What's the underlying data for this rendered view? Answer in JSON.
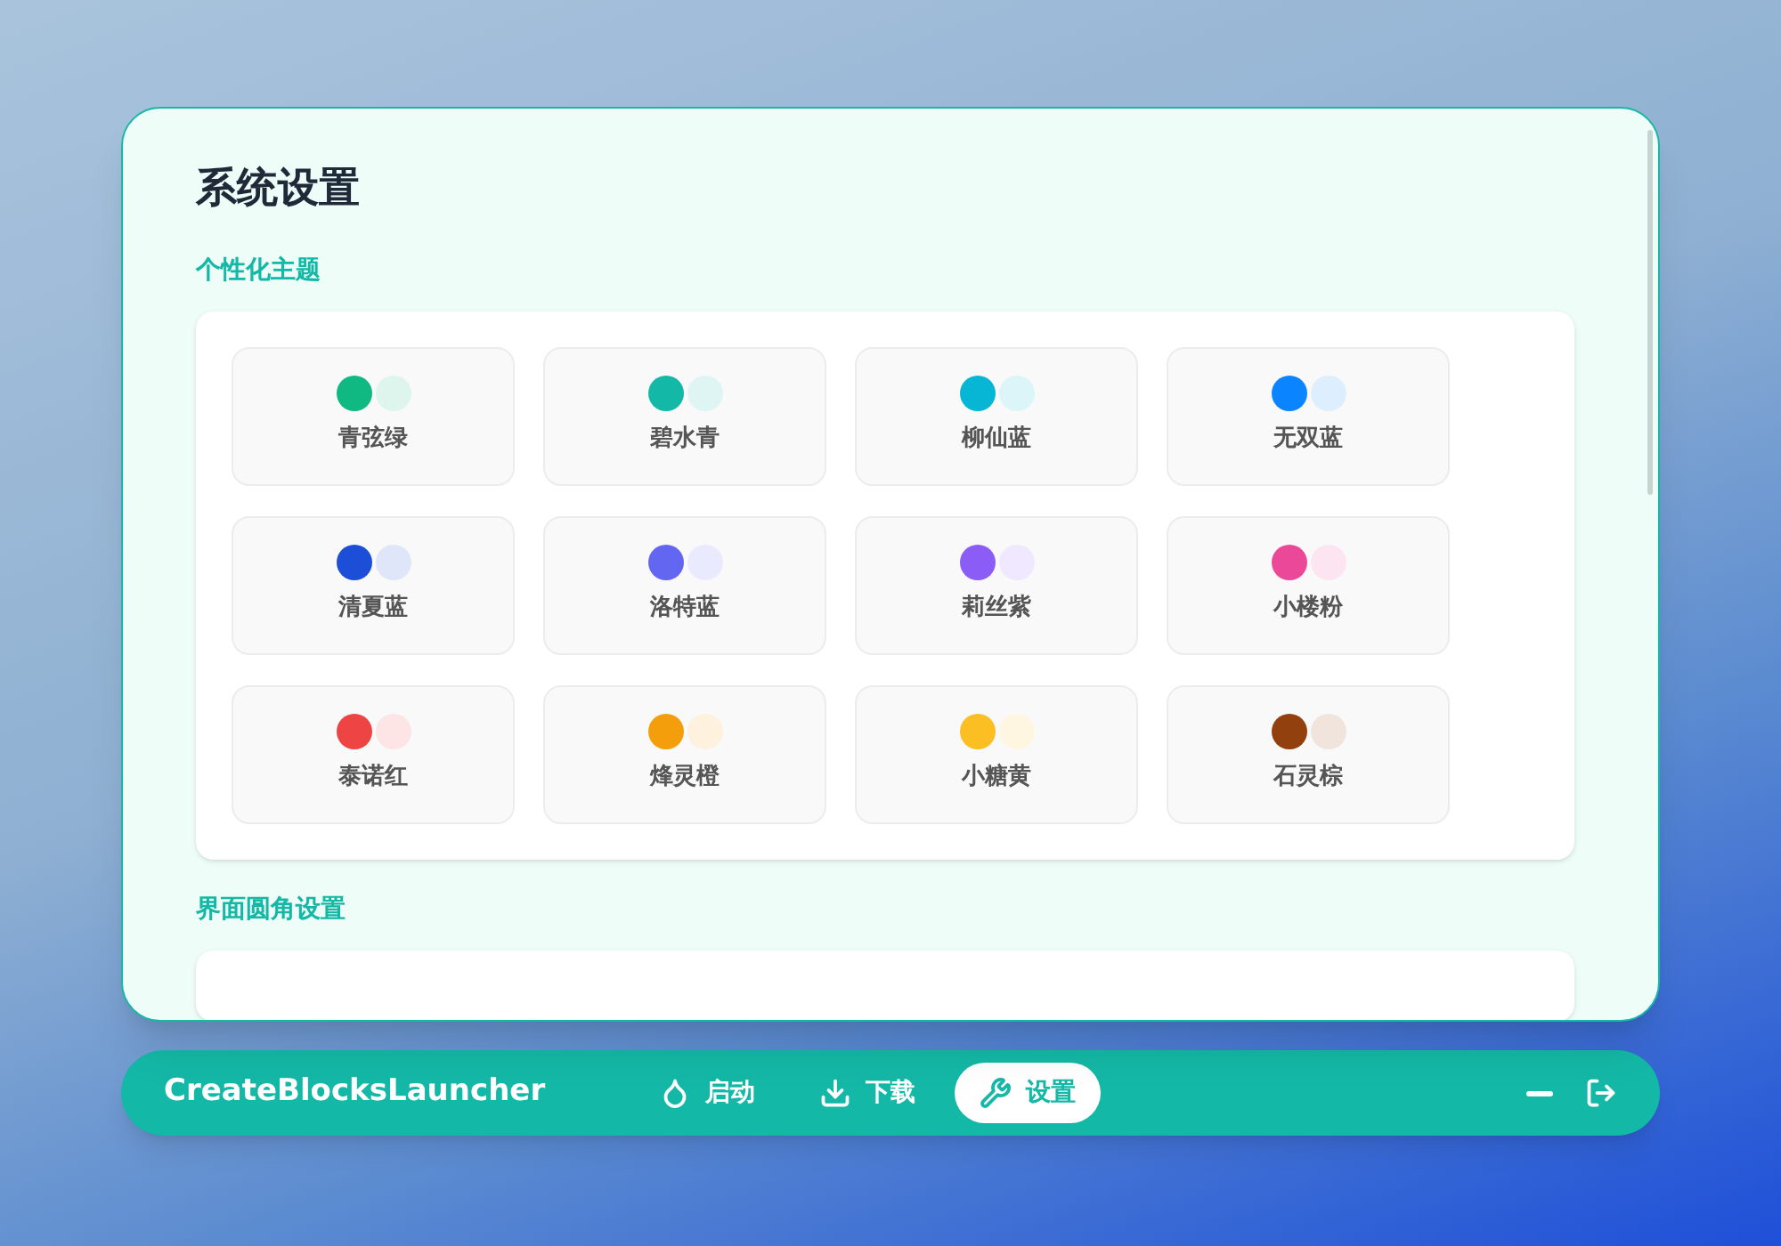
{
  "settings": {
    "title": "系统设置",
    "sections": [
      {
        "label": "个性化主题",
        "themes": [
          {
            "name": "青弦绿",
            "color": "#10b981"
          },
          {
            "name": "碧水青",
            "color": "#14b8a6"
          },
          {
            "name": "柳仙蓝",
            "color": "#06b6d4"
          },
          {
            "name": "无双蓝",
            "color": "#0a84ff"
          },
          {
            "name": "清夏蓝",
            "color": "#1d4ed8"
          },
          {
            "name": "洛特蓝",
            "color": "#6366f1"
          },
          {
            "name": "莉丝紫",
            "color": "#8b5cf6"
          },
          {
            "name": "小楼粉",
            "color": "#ec4899"
          },
          {
            "name": "泰诺红",
            "color": "#ef4444"
          },
          {
            "name": "烽灵橙",
            "color": "#f59e0b"
          },
          {
            "name": "小糖黄",
            "color": "#fbbf24"
          },
          {
            "name": "石灵棕",
            "color": "#92400e"
          }
        ]
      },
      {
        "label": "界面圆角设置"
      }
    ]
  },
  "nav": {
    "brand": "CreateBlocksLauncher",
    "items": [
      {
        "label": "启动",
        "selected": false
      },
      {
        "label": "下载",
        "selected": false
      },
      {
        "label": "设置",
        "selected": true
      }
    ]
  }
}
